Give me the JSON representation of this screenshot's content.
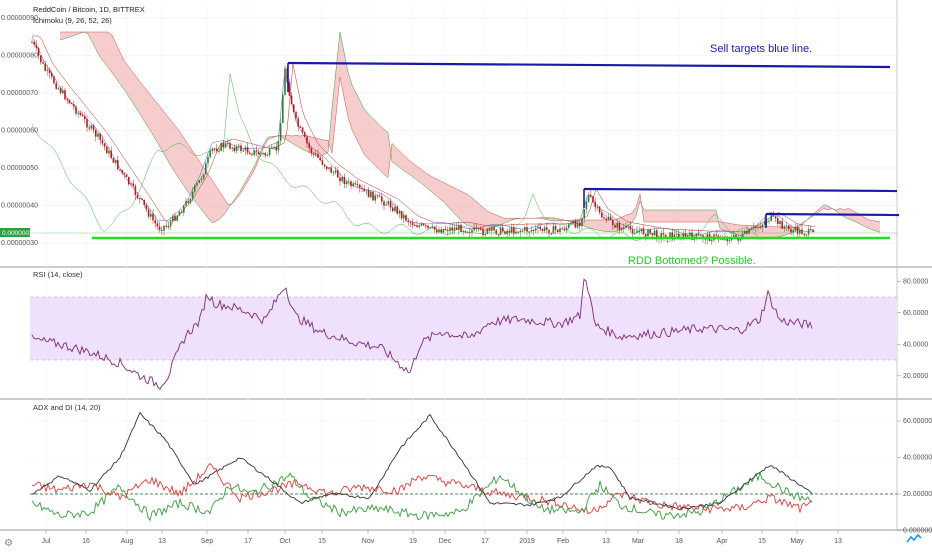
{
  "header": {
    "title": "ReddCoin / Bitcoin, 1D, BITTREX",
    "indicator": "Ichimoku (9, 26, 52, 26)"
  },
  "annotations": {
    "sell_targets": "Sell targets blue line.",
    "bottomed": "RDD Bottomed?  Possible."
  },
  "price_pane": {
    "axis_labels": [
      "0.00000090",
      "0.00000080",
      "0.00000070",
      "0.00000060",
      "0.00000050",
      "0.00000040",
      "0.00000030"
    ],
    "axis_values": [
      9e-07,
      8e-07,
      7e-07,
      6e-07,
      5e-07,
      4e-07,
      3e-07
    ],
    "current_price_label": "0.00000033",
    "current_price": 3.3e-07
  },
  "rsi_pane": {
    "label": "RSI (14, close)",
    "axis_labels": [
      "80.0000",
      "60.0000",
      "40.0000",
      "20.0000"
    ],
    "axis_values": [
      80,
      60,
      40,
      20
    ],
    "band": [
      30,
      70
    ]
  },
  "adx_pane": {
    "label": "ADX and DI (14, 20)",
    "axis_labels": [
      "60.00000000",
      "40.00000000",
      "20.00000000",
      "0.00000000"
    ],
    "axis_values": [
      60,
      40,
      20,
      0
    ],
    "threshold": 20
  },
  "time_axis": {
    "labels": [
      "Jul",
      "16",
      "Aug",
      "13",
      "Sep",
      "17",
      "Oct",
      "15",
      "Nov",
      "19",
      "Dec",
      "17",
      "2019",
      "Feb",
      "13",
      "Mar",
      "18",
      "Apr",
      "15",
      "May",
      "13"
    ]
  },
  "colors": {
    "blue_line": "#1a1aa8",
    "green_line": "#22dd22",
    "candle_up": "#2e7d32",
    "candle_down": "#b71c1c",
    "kumo_red": "#f4b6b6",
    "kumo_green": "#bfe6bf",
    "rsi_band": "#efe0fb",
    "rsi_line": "#7b2a7b",
    "adx_line": "#333333",
    "di_plus": "#3c9a3c",
    "di_minus": "#e03c3c"
  },
  "footer": {
    "logo_icon": "tradingview-logo",
    "corner_left": "⚙",
    "corner_right": "A"
  }
}
